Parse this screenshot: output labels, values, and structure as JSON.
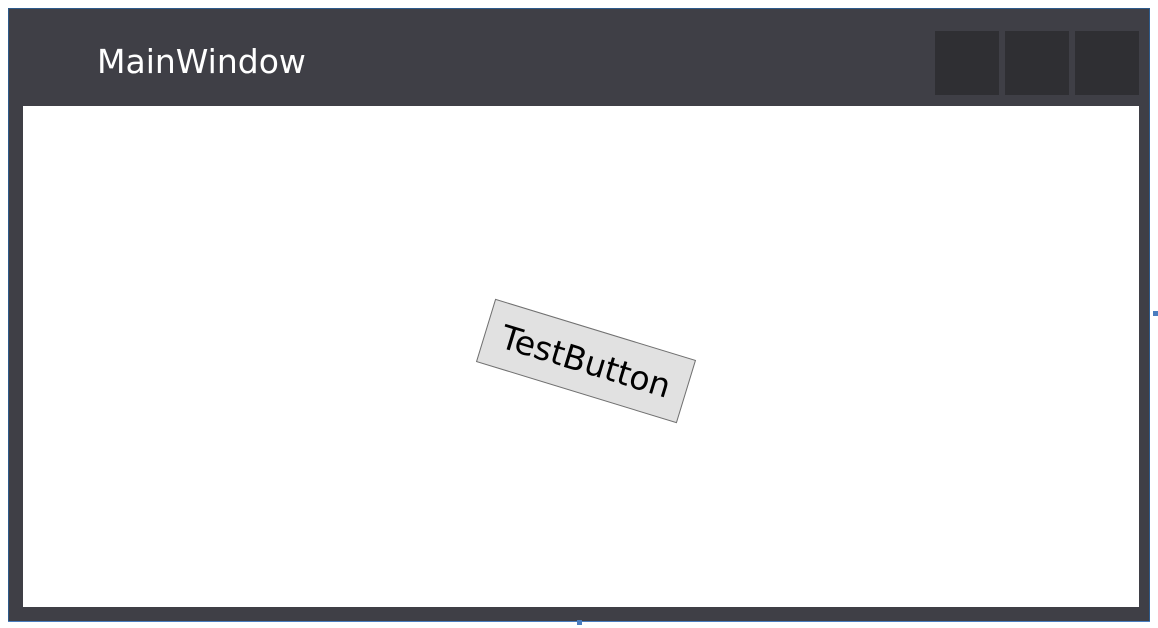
{
  "window": {
    "title": "MainWindow",
    "caption_buttons": [
      "minimize",
      "maximize",
      "close"
    ]
  },
  "content": {
    "button_label": "TestButton",
    "button_rotation_deg": 17
  },
  "colors": {
    "chrome": "#3f3f46",
    "caption_button": "#2f2f33",
    "client_background": "#ffffff",
    "button_background": "#e1e1e1",
    "button_border": "#707070",
    "selection_accent": "#4a7dbf"
  }
}
